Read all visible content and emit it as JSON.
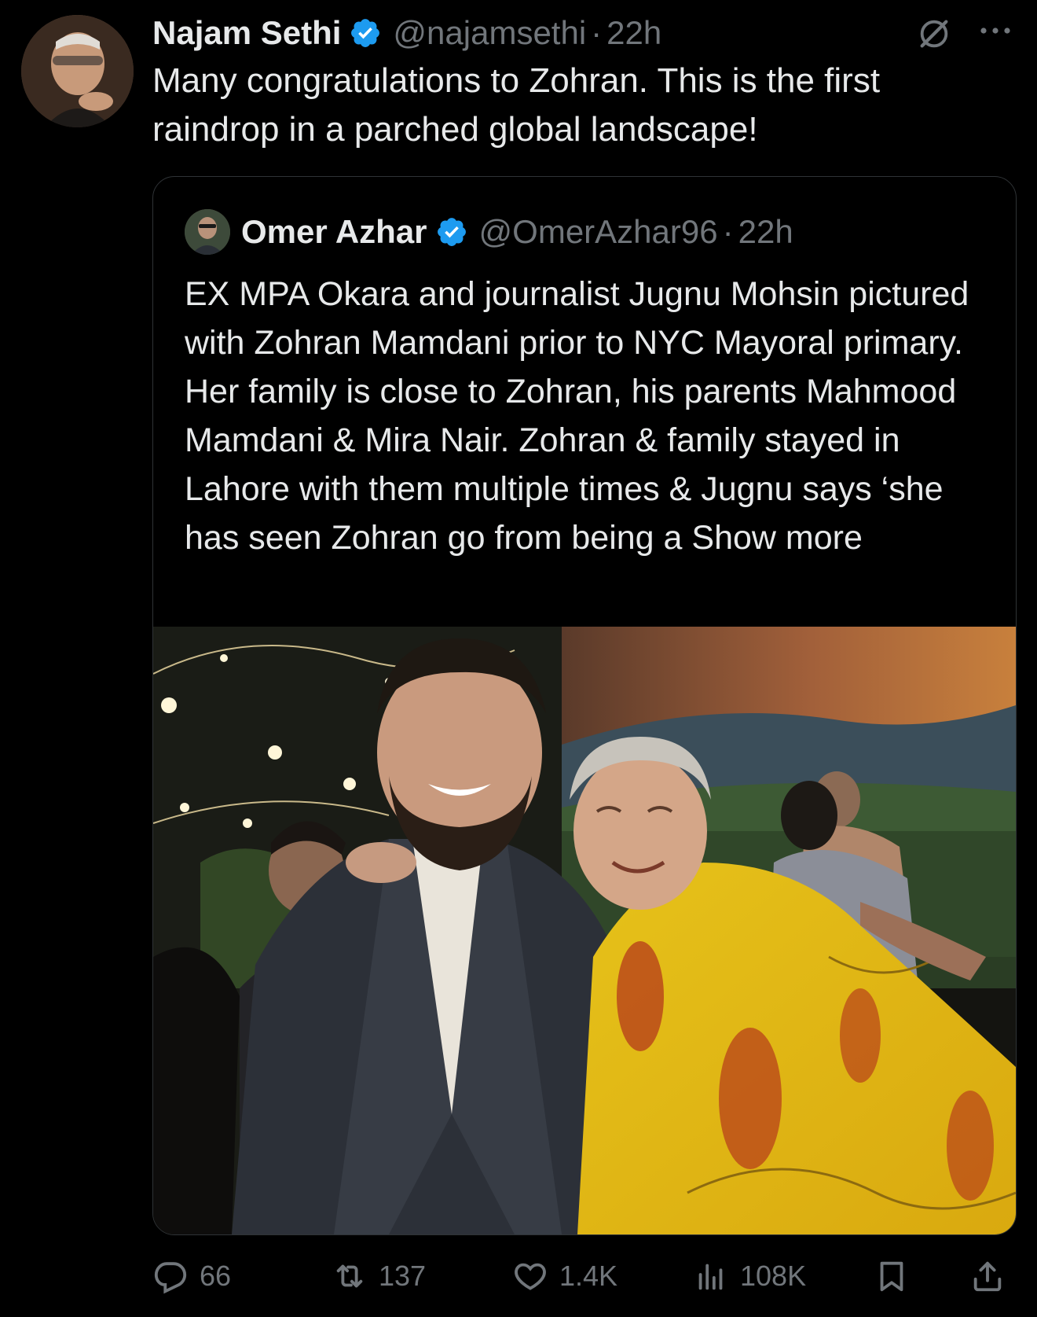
{
  "post": {
    "author_name": "Najam Sethi",
    "handle": "@najamsethi",
    "separator": "·",
    "time": "22h",
    "text": "Many congratulations to Zohran. This is the first raindrop in a parched global landscape!"
  },
  "quote": {
    "author_name": "Omer Azhar",
    "handle": "@OmerAzhar96",
    "separator": "·",
    "time": "22h",
    "text": "EX MPA Okara and journalist Jugnu Mohsin pictured with Zohran Mamdani prior to NYC Mayoral primary. Her family is close to Zohran, his parents Mahmood Mamdani & Mira Nair. Zohran & family stayed in Lahore with them multiple times & Jugnu says ‘she has seen Zohran go from being a",
    "show_more": "Show more"
  },
  "actions": {
    "replies": "66",
    "reposts": "137",
    "likes": "1.4K",
    "views": "108K"
  },
  "icons": {
    "verified": "verified-badge-icon",
    "grok": "grok-icon",
    "more": "more-icon",
    "reply": "reply-icon",
    "repost": "repost-icon",
    "like": "heart-icon",
    "views": "views-icon",
    "bookmark": "bookmark-icon",
    "share": "share-icon"
  },
  "colors": {
    "background": "#000000",
    "text_primary": "#e7e9ea",
    "text_secondary": "#71767b",
    "verified_blue": "#1d9bf0",
    "border": "#2f3336"
  }
}
